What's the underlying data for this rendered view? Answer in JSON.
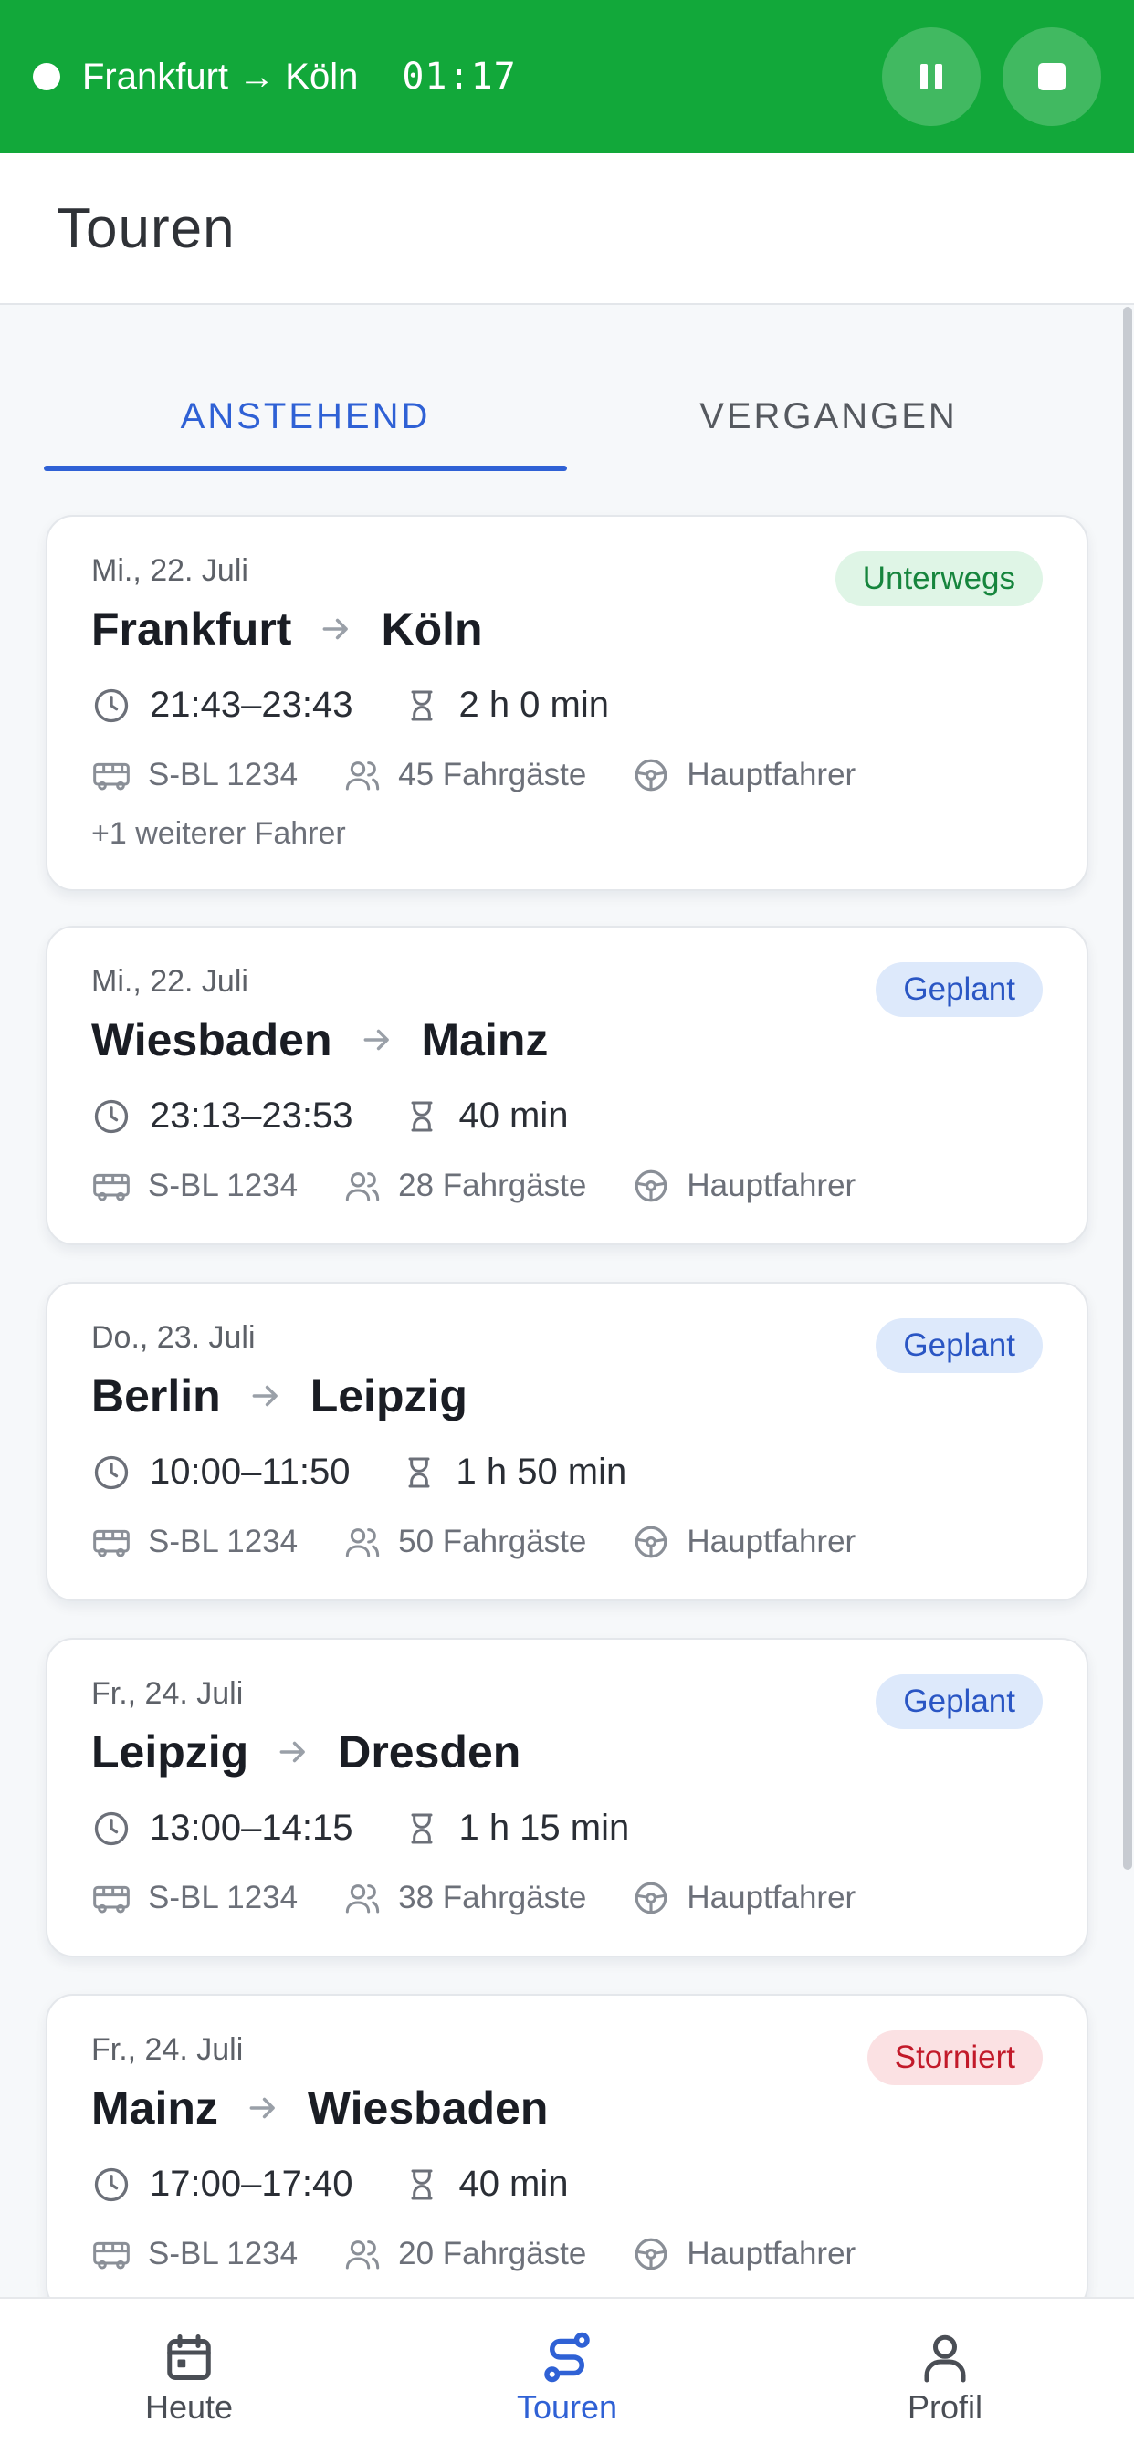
{
  "banner": {
    "route": "Frankfurt → Köln",
    "timer": "01:17",
    "color": "#12a83a",
    "pause_icon": "pause-icon",
    "stop_icon": "stop-icon"
  },
  "header": {
    "title": "Touren"
  },
  "tabs": [
    {
      "label": "ANSTEHEND",
      "active": true
    },
    {
      "label": "VERGANGEN",
      "active": false
    }
  ],
  "tours": [
    {
      "date": "Mi., 22. Juli",
      "from": "Frankfurt",
      "to": "Köln",
      "status": "Unterwegs",
      "status_color": "#16853d",
      "time": "21:43–23:43",
      "duration": "2 h 0 min",
      "vehicle": "S-BL 1234",
      "passengers": "45 Fahrgäste",
      "role": "Hauptfahrer",
      "extra": "+1 weiterer Fahrer"
    },
    {
      "date": "Mi., 22. Juli",
      "from": "Wiesbaden",
      "to": "Mainz",
      "status": "Geplant",
      "status_color": "#2a56c4",
      "time": "23:13–23:53",
      "duration": "40 min",
      "vehicle": "S-BL 1234",
      "passengers": "28 Fahrgäste",
      "role": "Hauptfahrer"
    },
    {
      "date": "Do., 23. Juli",
      "from": "Berlin",
      "to": "Leipzig",
      "status": "Geplant",
      "status_color": "#2a56c4",
      "time": "10:00–11:50",
      "duration": "1 h 50 min",
      "vehicle": "S-BL 1234",
      "passengers": "50 Fahrgäste",
      "role": "Hauptfahrer"
    },
    {
      "date": "Fr., 24. Juli",
      "from": "Leipzig",
      "to": "Dresden",
      "status": "Geplant",
      "status_color": "#2a56c4",
      "time": "13:00–14:15",
      "duration": "1 h 15 min",
      "vehicle": "S-BL 1234",
      "passengers": "38 Fahrgäste",
      "role": "Hauptfahrer"
    },
    {
      "date": "Fr., 24. Juli",
      "from": "Mainz",
      "to": "Wiesbaden",
      "status": "Storniert",
      "status_color": "#c21a2a",
      "time": "17:00–17:40",
      "duration": "40 min",
      "vehicle": "S-BL 1234",
      "passengers": "20 Fahrgäste",
      "role": "Hauptfahrer"
    }
  ],
  "nav": [
    {
      "label": "Heute",
      "icon": "calendar-icon",
      "active": false
    },
    {
      "label": "Touren",
      "icon": "route-icon",
      "active": true
    },
    {
      "label": "Profil",
      "icon": "person-icon",
      "active": false
    }
  ],
  "accent_color": "#2f61d5"
}
